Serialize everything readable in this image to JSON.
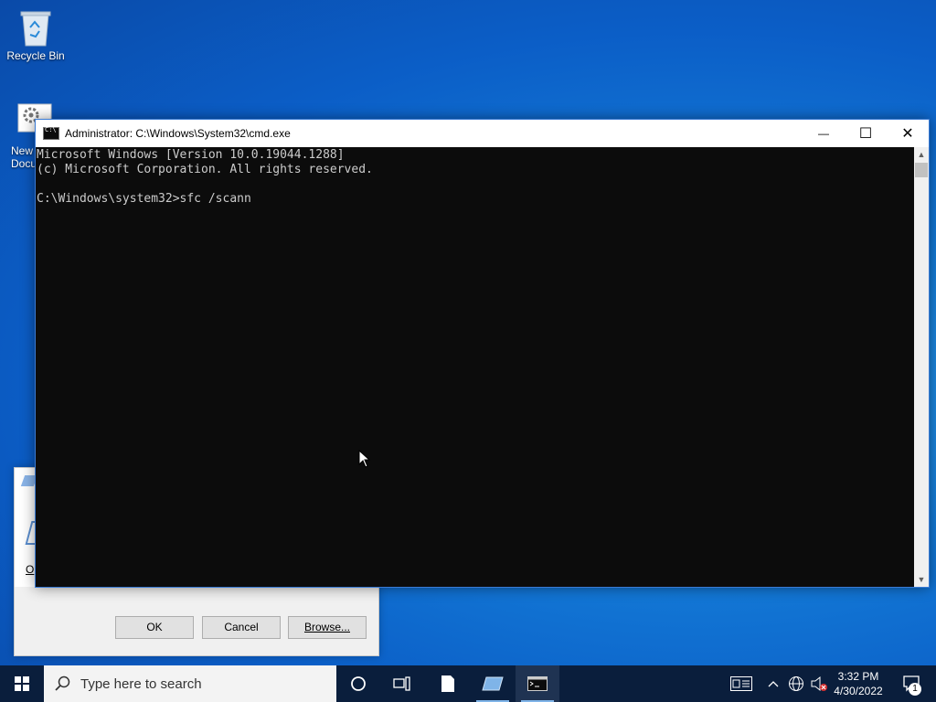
{
  "desktop": {
    "icons": [
      {
        "label": "Recycle Bin",
        "icon": "recycle-bin-icon"
      },
      {
        "label": "New Docu",
        "icon": "settings-document-icon"
      }
    ]
  },
  "run_dialog": {
    "partial_label": "O",
    "buttons": {
      "ok": "OK",
      "cancel": "Cancel",
      "browse": "Browse..."
    }
  },
  "cmd_window": {
    "title": "Administrator: C:\\Windows\\System32\\cmd.exe",
    "controls": {
      "minimize": "—",
      "maximize": "☐",
      "close": "✕"
    },
    "lines": [
      "Microsoft Windows [Version 10.0.19044.1288]",
      "(c) Microsoft Corporation. All rights reserved.",
      "",
      "C:\\Windows\\system32>sfc /scann"
    ]
  },
  "taskbar": {
    "search_placeholder": "Type here to search",
    "time": "3:32 PM",
    "date": "4/30/2022",
    "notification_count": "1"
  }
}
